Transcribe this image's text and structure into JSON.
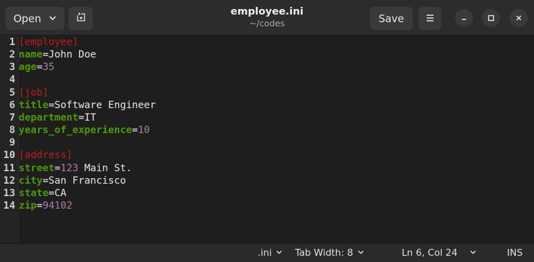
{
  "header": {
    "open_label": "Open",
    "title": "employee.ini",
    "subtitle": "~/codes",
    "save_label": "Save"
  },
  "editor": {
    "lines": [
      {
        "num": "1",
        "tokens": [
          {
            "t": "[employee]",
            "c": "sec"
          }
        ]
      },
      {
        "num": "2",
        "tokens": [
          {
            "t": "name",
            "c": "key"
          },
          {
            "t": "=",
            "c": "eq"
          },
          {
            "t": "John Doe",
            "c": "str"
          }
        ]
      },
      {
        "num": "3",
        "tokens": [
          {
            "t": "age",
            "c": "key"
          },
          {
            "t": "=",
            "c": "eq"
          },
          {
            "t": "35",
            "c": "num"
          }
        ]
      },
      {
        "num": "4",
        "tokens": []
      },
      {
        "num": "5",
        "tokens": [
          {
            "t": "[job]",
            "c": "sec"
          }
        ]
      },
      {
        "num": "6",
        "tokens": [
          {
            "t": "title",
            "c": "key"
          },
          {
            "t": "=",
            "c": "eq"
          },
          {
            "t": "Software Engineer",
            "c": "str"
          }
        ]
      },
      {
        "num": "7",
        "tokens": [
          {
            "t": "department",
            "c": "key"
          },
          {
            "t": "=",
            "c": "eq"
          },
          {
            "t": "IT",
            "c": "str"
          }
        ]
      },
      {
        "num": "8",
        "tokens": [
          {
            "t": "years_of_experience",
            "c": "key"
          },
          {
            "t": "=",
            "c": "eq"
          },
          {
            "t": "10",
            "c": "num"
          }
        ]
      },
      {
        "num": "9",
        "tokens": []
      },
      {
        "num": "10",
        "tokens": [
          {
            "t": "[address]",
            "c": "sec"
          }
        ]
      },
      {
        "num": "11",
        "tokens": [
          {
            "t": "street",
            "c": "key"
          },
          {
            "t": "=",
            "c": "eq"
          },
          {
            "t": "123",
            "c": "num"
          },
          {
            "t": " Main St.",
            "c": "str"
          }
        ]
      },
      {
        "num": "12",
        "tokens": [
          {
            "t": "city",
            "c": "key"
          },
          {
            "t": "=",
            "c": "eq"
          },
          {
            "t": "San Francisco",
            "c": "str"
          }
        ]
      },
      {
        "num": "13",
        "tokens": [
          {
            "t": "state",
            "c": "key"
          },
          {
            "t": "=",
            "c": "eq"
          },
          {
            "t": "CA",
            "c": "str"
          }
        ]
      },
      {
        "num": "14",
        "tokens": [
          {
            "t": "zip",
            "c": "key"
          },
          {
            "t": "=",
            "c": "eq"
          },
          {
            "t": "94102",
            "c": "num"
          }
        ]
      }
    ]
  },
  "status": {
    "language": ".ini",
    "tab_width": "Tab Width: 8",
    "cursor": "Ln 6, Col 24",
    "mode": "INS"
  },
  "colors": {
    "section": "#c01c1c",
    "key": "#4e9a06",
    "number": "#ad7fa8",
    "text": "#e8e8e8"
  },
  "icons": [
    "chevron-down-icon",
    "new-tab-icon",
    "hamburger-menu-icon",
    "minimize-icon",
    "maximize-icon",
    "close-icon"
  ]
}
